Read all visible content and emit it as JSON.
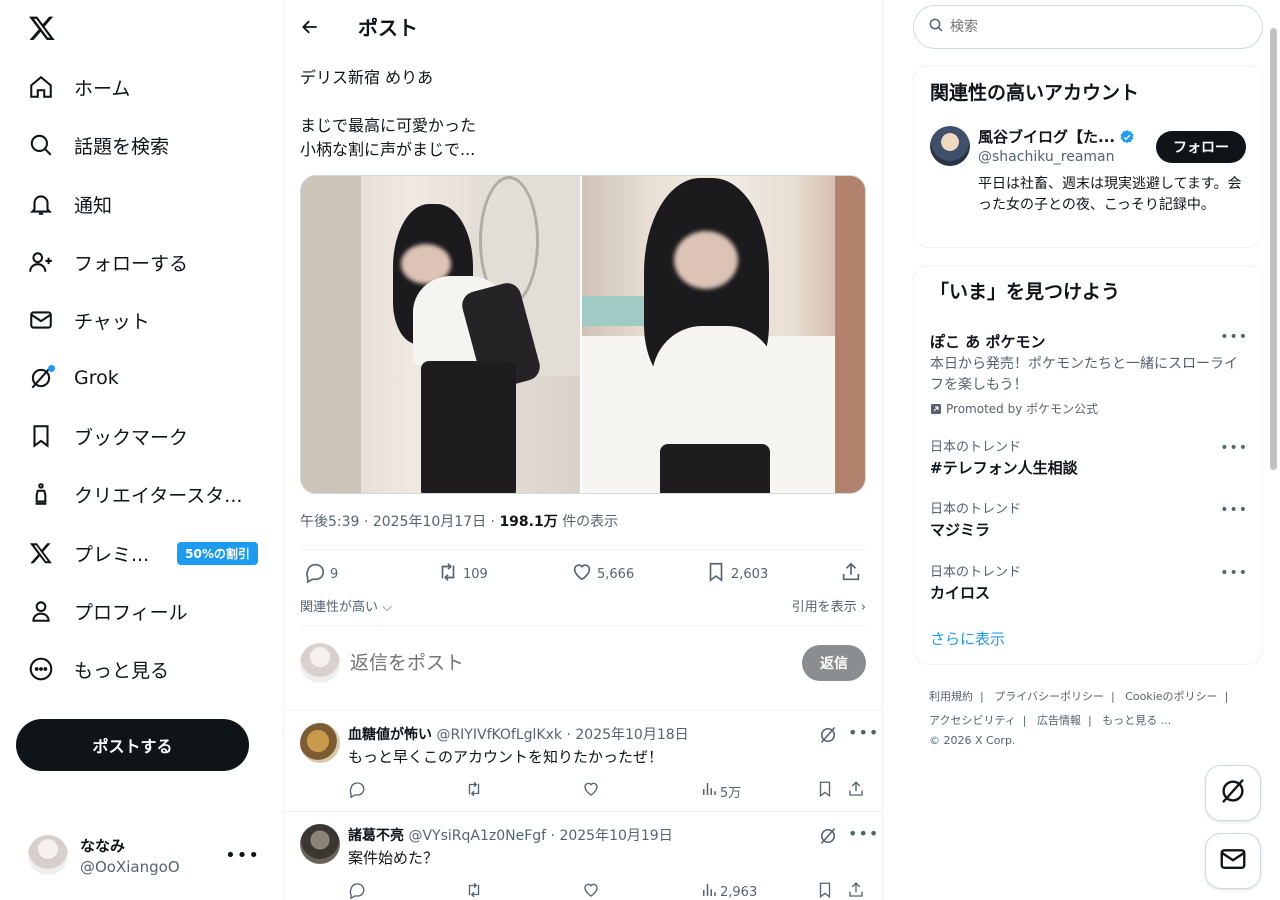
{
  "nav": {
    "items": [
      {
        "label": "ホーム"
      },
      {
        "label": "話題を検索"
      },
      {
        "label": "通知"
      },
      {
        "label": "フォローする"
      },
      {
        "label": "チャット"
      },
      {
        "label": "Grok"
      },
      {
        "label": "ブックマーク"
      },
      {
        "label": "クリエイタースタ..."
      },
      {
        "label": "プレミ...",
        "badge": "50%の割引"
      },
      {
        "label": "プロフィール"
      },
      {
        "label": "もっと見る"
      }
    ],
    "post_button": "ポストする",
    "account": {
      "name": "ななみ",
      "handle": "@OoXiangoO"
    }
  },
  "post": {
    "header": "ポスト",
    "text": "デリス新宿 めりあ\n\nまじで最高に可愛かった\n小柄な割に声がまじで...",
    "time": "午後5:39",
    "date": "2025年10月17日",
    "views": "198.1万",
    "views_suffix": "件の表示",
    "stats": {
      "replies": "9",
      "reposts": "109",
      "likes": "5,666",
      "bookmarks": "2,603"
    },
    "sort_label": "関連性が高い",
    "quotes_label": "引用を表示",
    "reply_placeholder": "返信をポスト",
    "reply_button": "返信"
  },
  "replies": [
    {
      "name": "血糖値が怖い",
      "handle": "@RIYIVfKOfLglKxk",
      "date": "2025年10月18日",
      "text": "もっと早くこのアカウントを知りたかったぜ！",
      "views": "5万"
    },
    {
      "name": "諸葛不亮",
      "handle": "@VYsiRqA1z0NeFgf",
      "date": "2025年10月19日",
      "text": "案件始めた？",
      "views": "2,963"
    }
  ],
  "right": {
    "search_placeholder": "検索",
    "who_to_follow": {
      "title": "関連性の高いアカウント",
      "name": "風谷ブイログ【た...",
      "handle": "@shachiku_reaman",
      "follow": "フォロー",
      "bio": "平日は社畜、週末は現実逃避してます。会った女の子との夜、こっそり記録中。"
    },
    "explore": {
      "title": "「いま」を見つけよう",
      "trends": [
        {
          "context": "",
          "name": "ぽこ あ ポケモン",
          "desc": "本日から発売！ポケモンたちと一緒にスローライフを楽しもう！",
          "promoted": "Promoted by ポケモン公式"
        },
        {
          "context": "日本のトレンド",
          "name": "#テレフォン人生相談"
        },
        {
          "context": "日本のトレンド",
          "name": "マジミラ"
        },
        {
          "context": "日本のトレンド",
          "name": "カイロス"
        }
      ],
      "show_more": "さらに表示"
    },
    "footer": {
      "links": [
        "利用規約",
        "プライバシーポリシー",
        "Cookieのポリシー",
        "アクセシビリティ",
        "広告情報",
        "もっと見る ..."
      ],
      "copyright": "© 2026 X Corp."
    }
  },
  "colors": {
    "accent": "#1d9bf0",
    "text": "#0f1419",
    "muted": "#536471",
    "border": "#eff3f4"
  }
}
